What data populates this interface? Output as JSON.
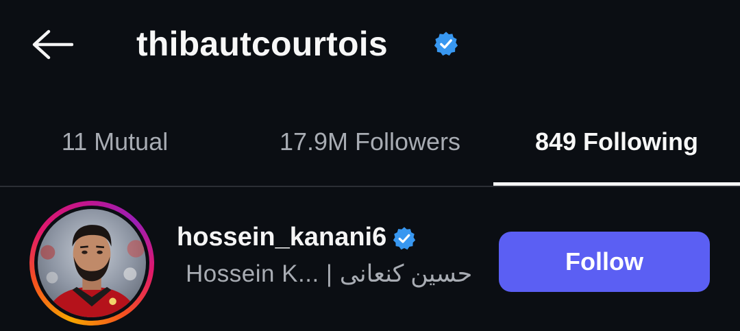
{
  "header": {
    "back_icon": "arrow-left-icon",
    "username": "thibautcourtois",
    "verified_icon": "verified-badge-icon"
  },
  "tabs": [
    {
      "label": "11 Mutual",
      "active": false
    },
    {
      "label": "17.9M Followers",
      "active": false
    },
    {
      "label": "849 Following",
      "active": true
    }
  ],
  "list": {
    "items": [
      {
        "handle": "hossein_kanani6",
        "verified_icon": "verified-badge-icon",
        "full_name": "Hossein K... | حسین کنعانی",
        "avatar_icon": "profile-photo",
        "follow_label": "Follow"
      }
    ]
  },
  "colors": {
    "background": "#0b0e13",
    "accent_button": "#5b5ff3",
    "verified_blue": "#3897f0",
    "muted_text": "#a8acb3"
  }
}
